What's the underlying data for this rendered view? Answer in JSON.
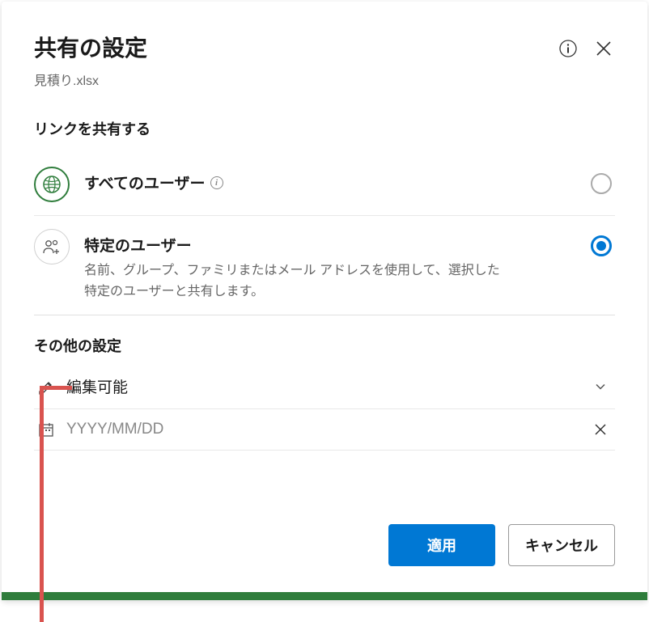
{
  "header": {
    "title": "共有の設定",
    "filename": "見積り.xlsx"
  },
  "share": {
    "heading": "リンクを共有する",
    "options": {
      "anyone": {
        "title": "すべてのユーザー"
      },
      "specific": {
        "title": "特定のユーザー",
        "description": "名前、グループ、ファミリまたはメール アドレスを使用して、選択した特定のユーザーと共有します。"
      }
    }
  },
  "other": {
    "heading": "その他の設定",
    "permission": "編集可能",
    "date_placeholder": "YYYY/MM/DD"
  },
  "footer": {
    "apply": "適用",
    "cancel": "キャンセル"
  }
}
